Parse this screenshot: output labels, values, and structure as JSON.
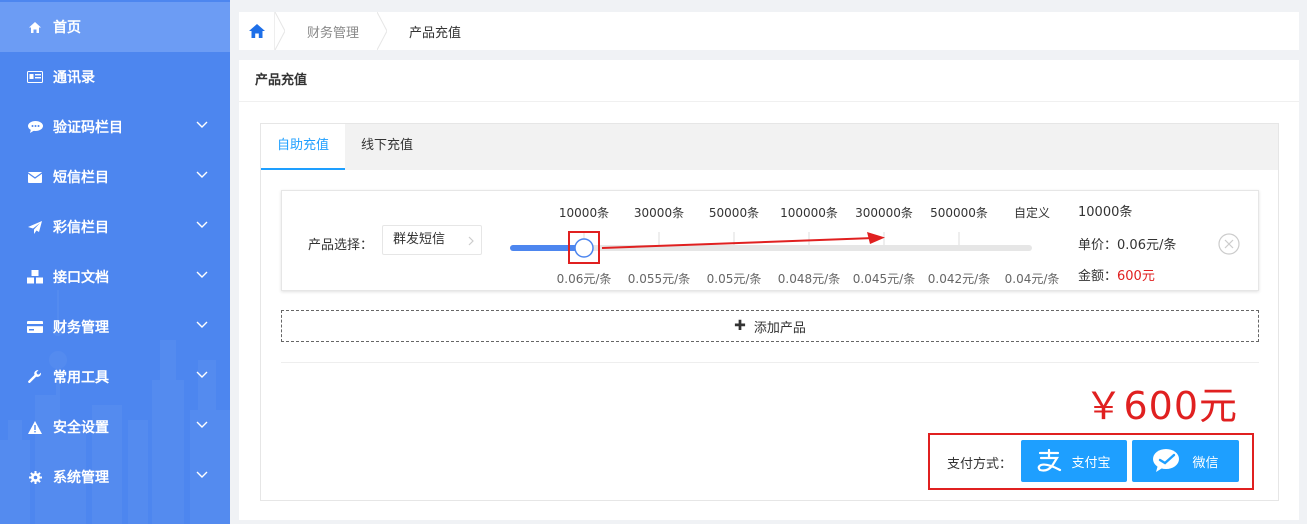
{
  "sidebar": {
    "items": [
      {
        "label": "首页",
        "icon": "home-icon",
        "active": true
      },
      {
        "label": "通讯录",
        "icon": "contact-card-icon"
      },
      {
        "label": "验证码栏目",
        "icon": "chat-bubble-icon"
      },
      {
        "label": "短信栏目",
        "icon": "envelope-icon"
      },
      {
        "label": "彩信栏目",
        "icon": "paper-plane-icon"
      },
      {
        "label": "接口文档",
        "icon": "cubes-icon"
      },
      {
        "label": "财务管理",
        "icon": "credit-card-icon"
      },
      {
        "label": "常用工具",
        "icon": "wrench-icon"
      },
      {
        "label": "安全设置",
        "icon": "warning-icon"
      },
      {
        "label": "系统管理",
        "icon": "gear-icon"
      }
    ]
  },
  "breadcrumb": {
    "items": [
      "财务管理",
      "产品充值"
    ]
  },
  "panel": {
    "title": "产品充值"
  },
  "tabs": [
    {
      "label": "自助充值",
      "active": true
    },
    {
      "label": "线下充值"
    }
  ],
  "product": {
    "select_label": "产品选择：",
    "selected": "群发短信",
    "tiers": [
      {
        "qty": "10000条",
        "price": "0.06元/条"
      },
      {
        "qty": "30000条",
        "price": "0.055元/条"
      },
      {
        "qty": "50000条",
        "price": "0.05元/条"
      },
      {
        "qty": "100000条",
        "price": "0.048元/条"
      },
      {
        "qty": "300000条",
        "price": "0.045元/条"
      },
      {
        "qty": "500000条",
        "price": "0.042元/条"
      },
      {
        "qty": "自定义",
        "price": "0.04元/条"
      }
    ],
    "slider_value_index": 0,
    "summary_qty": "10000条",
    "unit_price_label": "单价：",
    "unit_price": "0.06元/条",
    "amount_label": "金额：",
    "amount": "600元"
  },
  "add_product_label": "添加产品",
  "total": "￥600元",
  "payment": {
    "label": "支付方式：",
    "alipay": "支付宝",
    "wechat": "微信"
  },
  "colors": {
    "sidebar": "#4d86ef",
    "accent": "#1e9fff",
    "highlight_red": "#e02020"
  }
}
